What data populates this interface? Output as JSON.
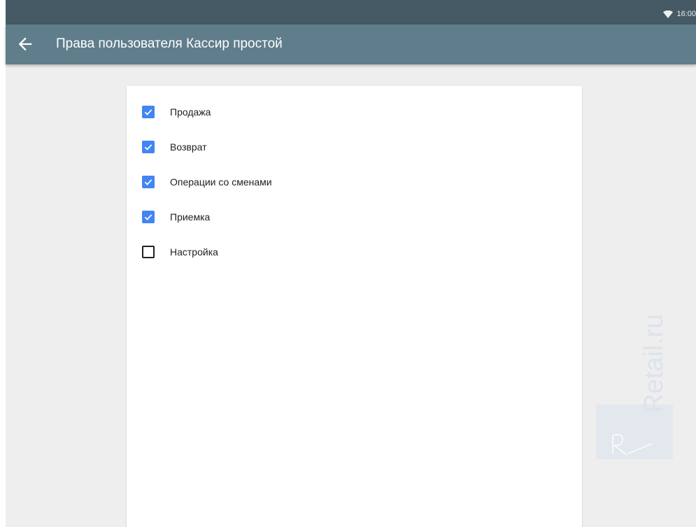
{
  "status_bar": {
    "time": "16:00",
    "wifi_icon": "wifi-icon"
  },
  "app_bar": {
    "back_icon": "arrow-back-icon",
    "title": "Права пользователя Кассир простой"
  },
  "permissions": [
    {
      "label": "Продажа",
      "checked": true
    },
    {
      "label": "Возврат",
      "checked": true
    },
    {
      "label": "Операции со сменами",
      "checked": true
    },
    {
      "label": "Приемка",
      "checked": true
    },
    {
      "label": "Настройка",
      "checked": false
    }
  ],
  "watermark": {
    "text": "Retail.ru"
  },
  "colors": {
    "status_bar": "#455a64",
    "app_bar": "#607d8b",
    "checkbox_checked": "#4285f4",
    "background": "#eeeeee"
  }
}
